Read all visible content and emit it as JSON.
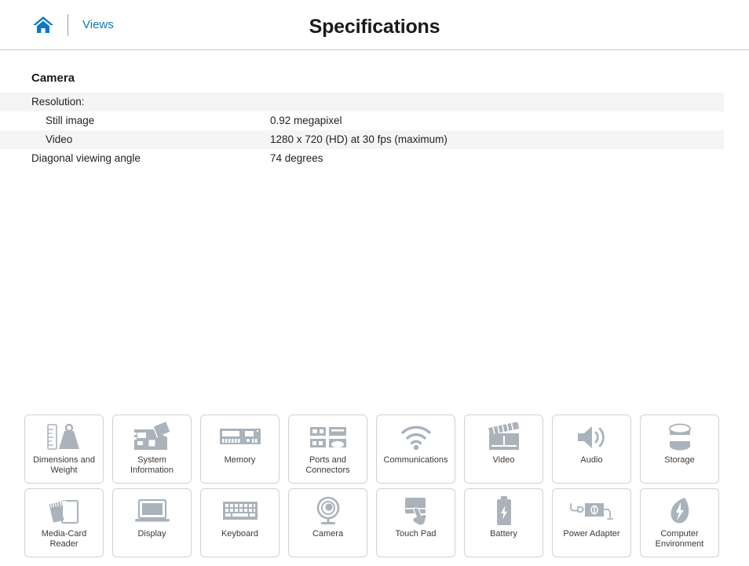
{
  "header": {
    "home_icon": "home-icon",
    "views_label": "Views",
    "title": "Specifications"
  },
  "spec": {
    "section_title": "Camera",
    "rows": [
      {
        "key": "Resolution:",
        "value": "",
        "indent": false,
        "striped": true
      },
      {
        "key": "Still image",
        "value": "0.92 megapixel",
        "indent": true,
        "striped": false
      },
      {
        "key": "Video",
        "value": "1280 x 720 (HD) at 30 fps (maximum)",
        "indent": true,
        "striped": true
      },
      {
        "key": "Diagonal viewing angle",
        "value": "74 degrees",
        "indent": false,
        "striped": false
      }
    ]
  },
  "tiles": [
    {
      "label": "Dimensions and\nWeight",
      "icon": "ruler-weight-icon"
    },
    {
      "label": "System\nInformation",
      "icon": "motherboard-icon"
    },
    {
      "label": "Memory",
      "icon": "memory-module-icon"
    },
    {
      "label": "Ports and\nConnectors",
      "icon": "ports-icon"
    },
    {
      "label": "Communications",
      "icon": "wifi-icon"
    },
    {
      "label": "Video",
      "icon": "clapperboard-icon"
    },
    {
      "label": "Audio",
      "icon": "speaker-icon"
    },
    {
      "label": "Storage",
      "icon": "drive-cylinder-icon"
    },
    {
      "label": "Media-Card\nReader",
      "icon": "media-card-icon"
    },
    {
      "label": "Display",
      "icon": "laptop-display-icon"
    },
    {
      "label": "Keyboard",
      "icon": "keyboard-icon"
    },
    {
      "label": "Camera",
      "icon": "webcam-icon"
    },
    {
      "label": "Touch Pad",
      "icon": "touchpad-hand-icon"
    },
    {
      "label": "Battery",
      "icon": "battery-icon"
    },
    {
      "label": "Power Adapter",
      "icon": "power-adapter-icon"
    },
    {
      "label": "Computer\nEnvironment",
      "icon": "leaf-icon"
    }
  ],
  "colors": {
    "accent_blue": "#0c7ac0",
    "icon_gray": "#aab2bb",
    "row_stripe": "#f5f5f5",
    "border_gray": "#cfd2d5"
  }
}
